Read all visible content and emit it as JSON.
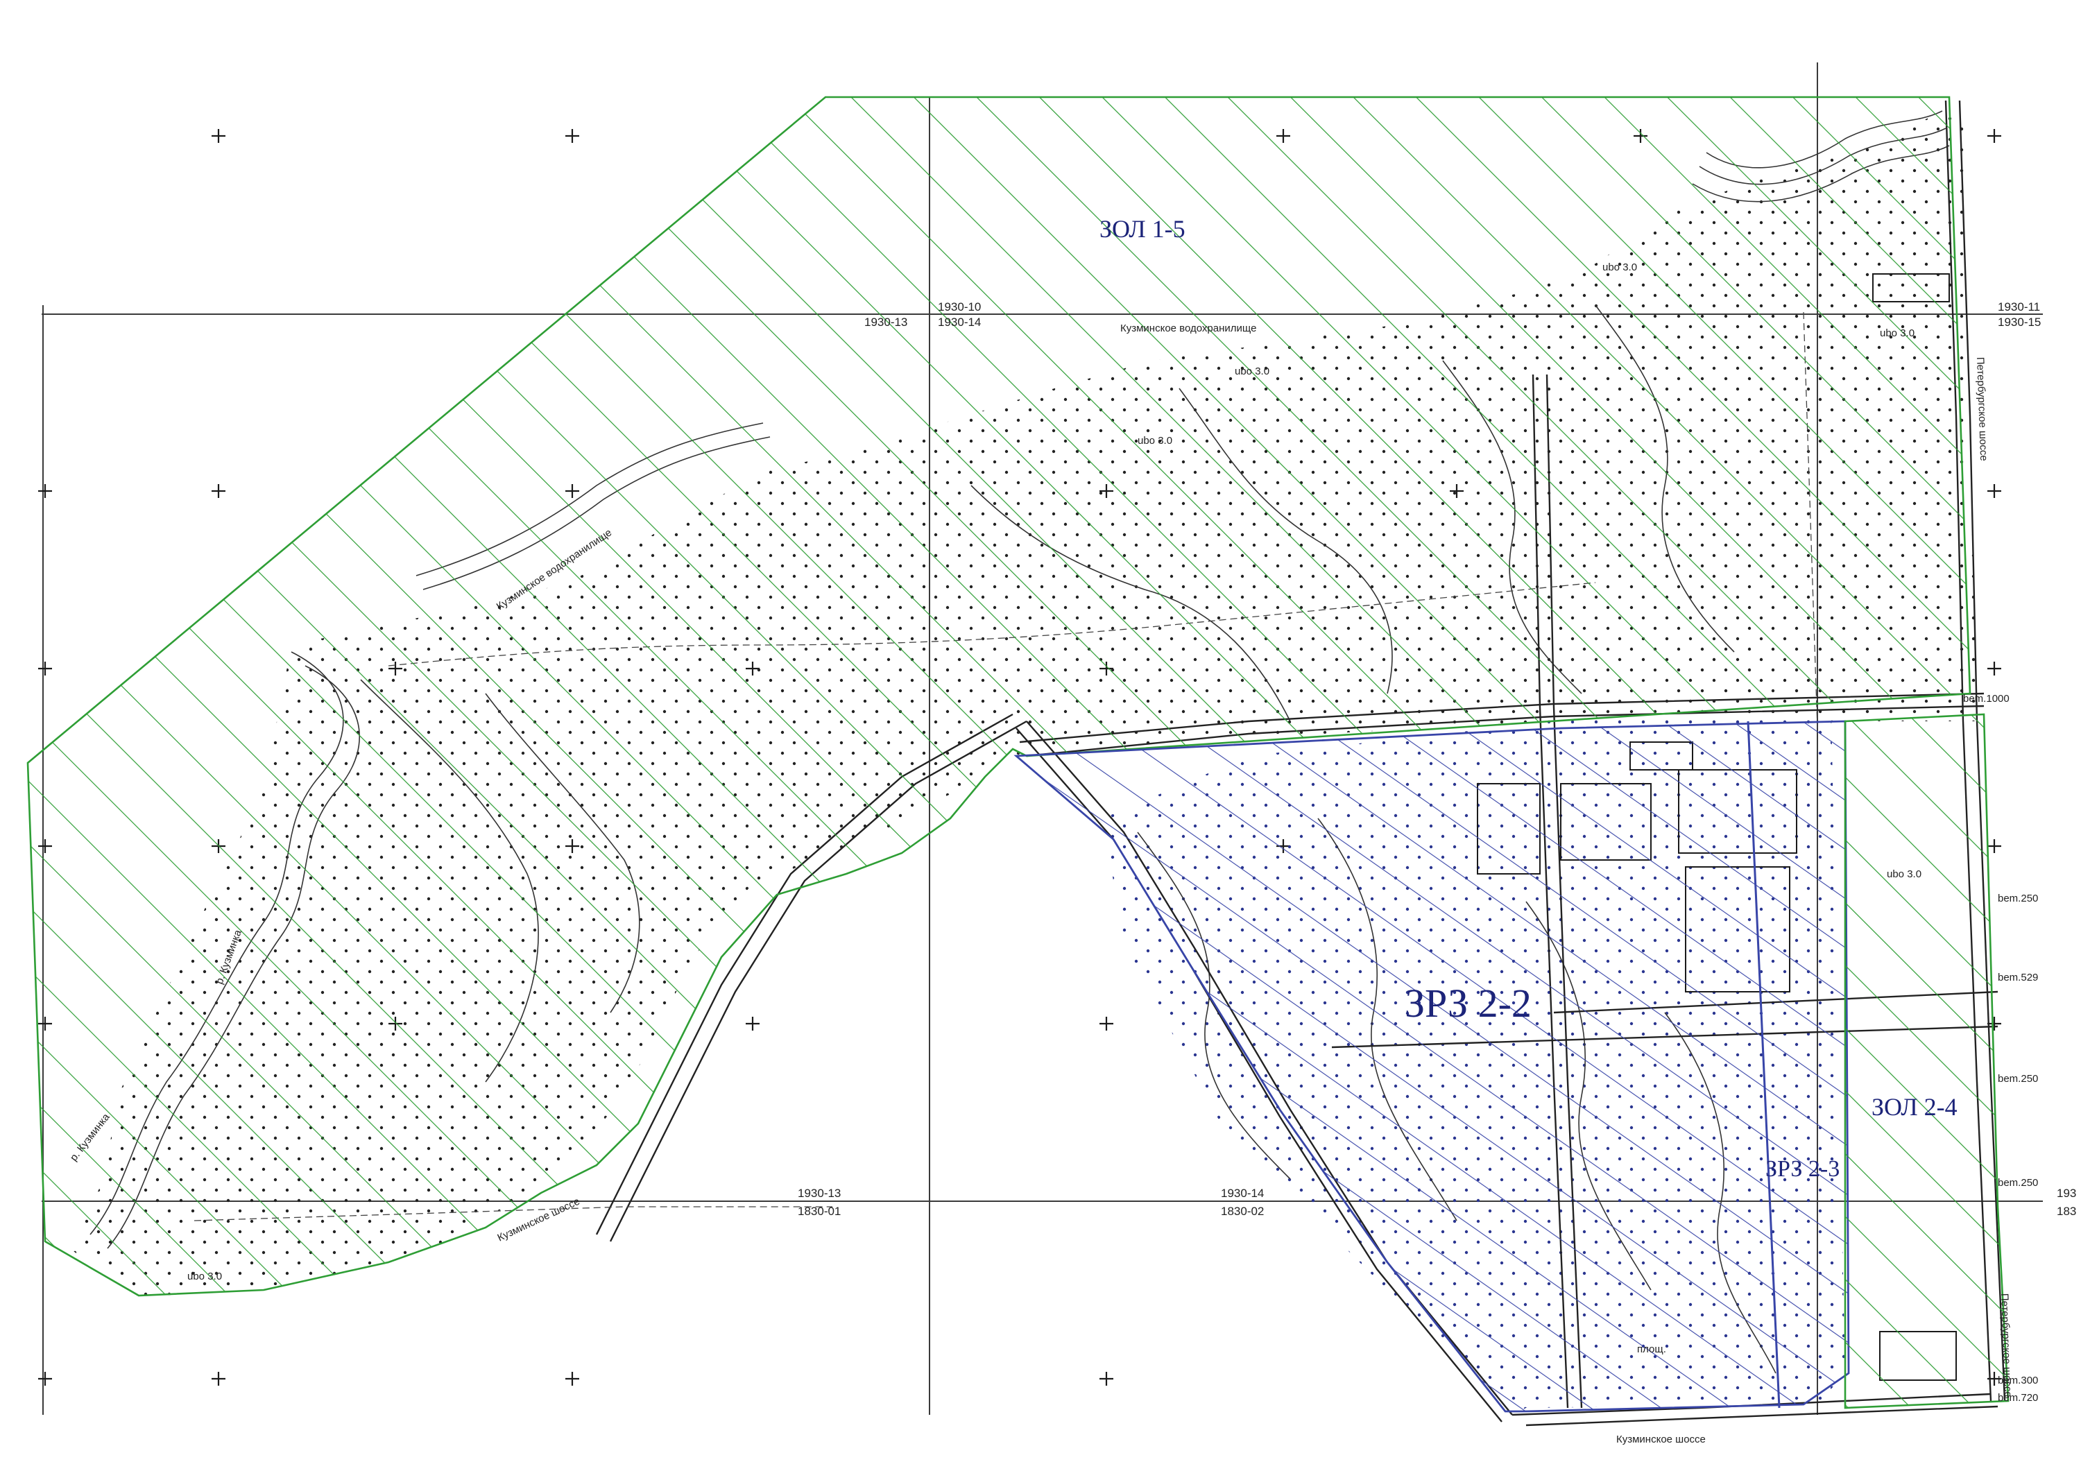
{
  "colors": {
    "zol_green": "#2e9e35",
    "zrz_blue": "#3845a8",
    "label_navy": "#1c2479",
    "grid": "#3a3a3a"
  },
  "zones": {
    "zol_1_5": "ЗОЛ 1-5",
    "zrz_2_2": "ЗРЗ 2-2",
    "zrz_2_3": "ЗРЗ 2-3",
    "zol_2_4": "ЗОЛ 2-4"
  },
  "sheets": {
    "top_left_a": "1930-13",
    "top_mid_a": "1930-10",
    "top_mid_b": "1930-14",
    "top_right_a": "1930-11",
    "top_right_b": "1930-15",
    "bottom_left_a": "1930-13",
    "bottom_left_b": "1830-01",
    "bottom_mid_a": "1930-14",
    "bottom_mid_b": "1830-02",
    "bottom_right_a": "193",
    "bottom_right_b": "183"
  },
  "streets": {
    "petersburg_top": "Петербургское шоссе",
    "petersburg_bottom": "Петербургское шоссе",
    "kuzminskoye_shosse": "Кузминское шоссе",
    "kuzminskoye_vodokhranilishche": "Кузминское водохранилище",
    "kuzminskoye_vodokh_small": "Кузминское водохранилище",
    "river_upper": "р. Кузминка",
    "river_lower": "р. Кузминка",
    "kuzminskoye_shosse_diag": "Кузминское шоссе"
  },
  "annotations": {
    "ubo_1": "ubo 3.0",
    "ubo_2": "ubo 3.0",
    "ubo_3": "ubo 3.0",
    "ubo_4": "ubo 3.0",
    "ubo_5": "ubo 3.0",
    "ubo_6": "ubo 3.0",
    "npsh_1": "площ.",
    "bem_1": "bem.1000",
    "bem_2": "bem.250",
    "bem_3": "bem.250",
    "bem_4": "bem.250",
    "bem_5": "bem.300",
    "bem_6": "bem.529",
    "bem_7": "bem.720"
  }
}
